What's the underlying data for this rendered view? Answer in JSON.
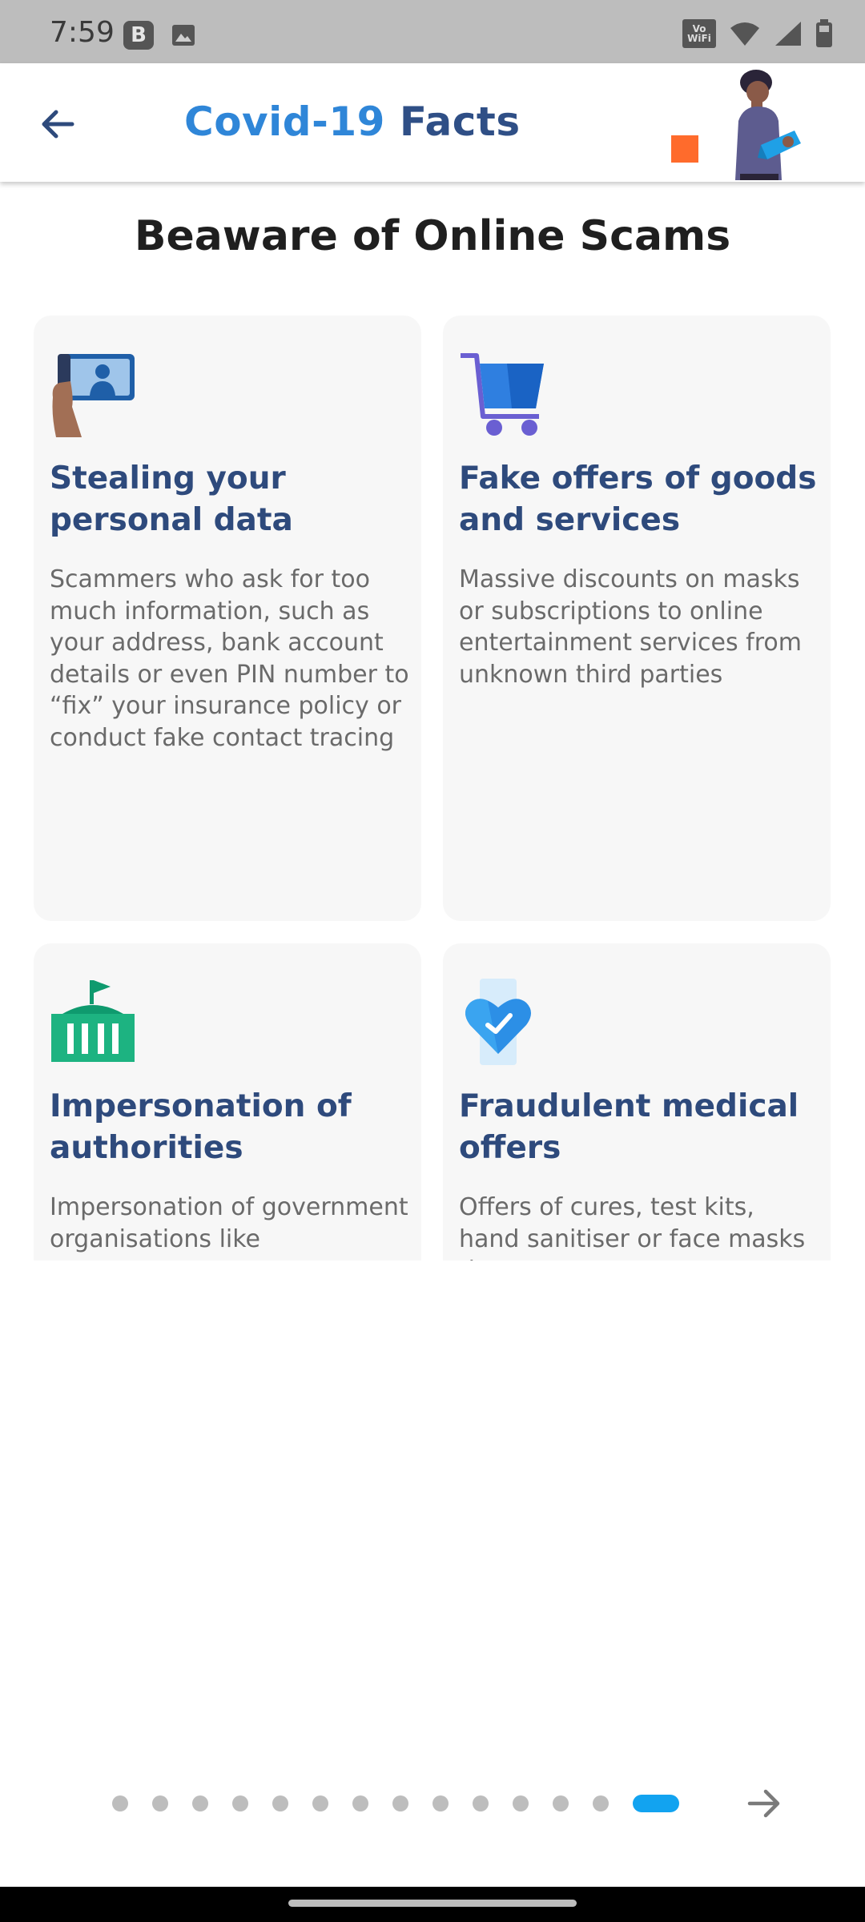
{
  "status_bar": {
    "time": "7:59",
    "b_badge": "B",
    "wifi_label": "Vo WiFi",
    "icons": [
      "image-icon",
      "wifi-icon",
      "signal-icon",
      "battery-icon"
    ]
  },
  "app_bar": {
    "title_part1": "Covid-19",
    "title_part2": "Facts",
    "back_icon": "back-arrow-icon",
    "colors": {
      "title_accent": "#2f86d8",
      "title_dark": "#2f4f86",
      "orange": "#ff6b2c"
    }
  },
  "page": {
    "title": "Beaware of Online Scams"
  },
  "cards": [
    {
      "icon": "phone-contact-icon",
      "title": "Stealing your personal data",
      "body": "Scammers who ask for too much information, such as your address, bank account details or even PIN number to “fix” your insurance policy or conduct fake contact tracing"
    },
    {
      "icon": "shopping-cart-icon",
      "title": "Fake offers of goods and services",
      "body": "Massive discounts on masks or subscriptions to online entertainment services from unknown third parties"
    },
    {
      "icon": "government-building-icon",
      "title": "Impersonation of authorities",
      "body": "Impersonation of government organisations like"
    },
    {
      "icon": "heart-check-icon",
      "title": "Fraudulent medical offers",
      "body": "Offers of cures, test kits, hand sanitiser or face masks that are not"
    }
  ],
  "pagination": {
    "total": 14,
    "current": 14,
    "next_icon": "arrow-right-icon",
    "active_color": "#12a3f0"
  }
}
